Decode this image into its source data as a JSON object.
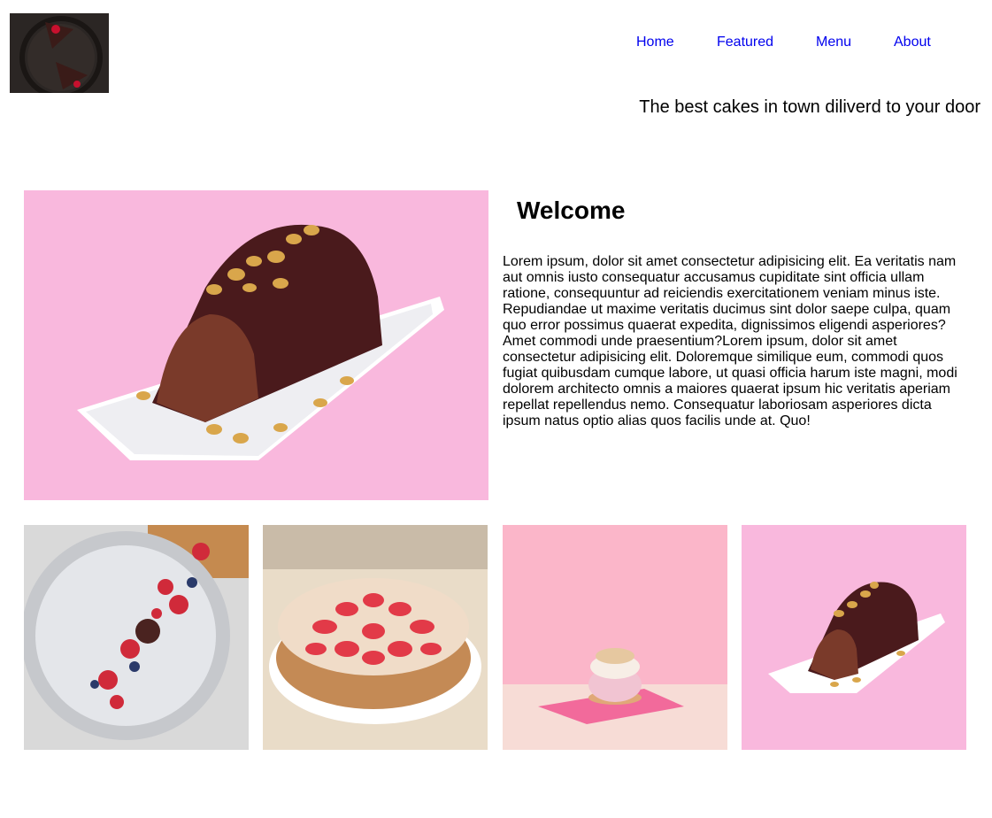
{
  "header": {
    "logo_name": "logo-cake-image",
    "nav": [
      {
        "label": "Home"
      },
      {
        "label": "Featured"
      },
      {
        "label": "Menu"
      },
      {
        "label": "About"
      }
    ],
    "tagline": "The best cakes in town diliverd to your door"
  },
  "main": {
    "title": "Welcome",
    "body": "Lorem ipsum, dolor sit amet consectetur adipisicing elit. Ea veritatis nam aut omnis iusto consequatur accusamus cupiditate sint officia ullam ratione, consequuntur ad reiciendis exercitationem veniam minus iste. Repudiandae ut maxime veritatis ducimus sint dolor saepe culpa, quam quo error possimus quaerat expedita, dignissimos eligendi asperiores? Amet commodi unde praesentium?Lorem ipsum, dolor sit amet consectetur adipisicing elit. Doloremque similique eum, commodi quos fugiat quibusdam cumque labore, ut quasi officia harum iste magni, modi dolorem architecto omnis a maiores quaerat ipsum hic veritatis aperiam repellat repellendus nemo. Consequatur laboriosam asperiores dicta ipsum natus optio alias quos facilis unde at. Quo!"
  },
  "colors": {
    "link": "#0000ee",
    "pink_background": "#f9b6dc",
    "chocolate": "#4a1c1a"
  }
}
